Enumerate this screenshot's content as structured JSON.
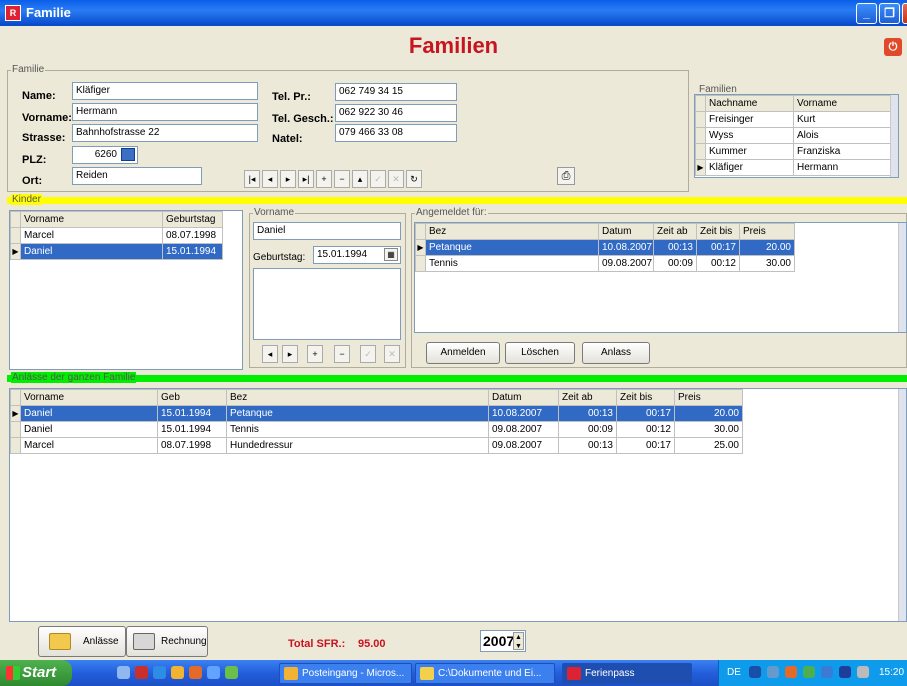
{
  "window": {
    "title": "Familie",
    "app_icon": "app-icon",
    "buttons": [
      "minimize-icon",
      "maximize-icon",
      "close-icon"
    ]
  },
  "page_title": "Familien",
  "familie": {
    "group_label": "Familie",
    "name_label": "Name:",
    "name": "Kläfiger",
    "vorname_label": "Vorname:",
    "vorname": "Hermann",
    "strasse_label": "Strasse:",
    "strasse": "Bahnhofstrasse 22",
    "plz_label": "PLZ:",
    "plz": "6260",
    "ort_label": "Ort:",
    "ort": "Reiden",
    "tel_pr_label": "Tel. Pr.:",
    "tel_pr": "062 749 34 15",
    "tel_gesch_label": "Tel. Gesch.:",
    "tel_gesch": "062 922 30 46",
    "natel_label": "Natel:",
    "natel": "079 466 33 08",
    "nav_icons": [
      "first-icon",
      "prev-icon",
      "next-icon",
      "last-icon",
      "add-icon",
      "delete-icon",
      "edit-icon",
      "post-icon",
      "cancel-icon",
      "refresh-icon"
    ]
  },
  "familien_list": {
    "group_label": "Familien",
    "columns": [
      "Nachname",
      "Vorname"
    ],
    "rows": [
      [
        "Freisinger",
        "Kurt"
      ],
      [
        "Wyss",
        "Alois"
      ],
      [
        "Kummer",
        "Franziska"
      ],
      [
        "Kläfiger",
        "Hermann"
      ]
    ],
    "current_row": 3
  },
  "kinder": {
    "bar_label": "Kinder",
    "columns": [
      "Vorname",
      "Geburtstag"
    ],
    "rows": [
      [
        "Marcel",
        "08.07.1998"
      ],
      [
        "Daniel",
        "15.01.1994"
      ]
    ],
    "selected_row": 1,
    "detail": {
      "group_label": "Vorname",
      "vorname": "Daniel",
      "geburtstag_label": "Geburtstag:",
      "geburtstag": "15.01.1994"
    }
  },
  "angemeldet": {
    "group_label": "Angemeldet für:",
    "columns": [
      "Bez",
      "Datum",
      "Zeit ab",
      "Zeit bis",
      "Preis"
    ],
    "rows": [
      [
        "Petanque",
        "10.08.2007",
        "00:13",
        "00:17",
        "20.00"
      ],
      [
        "Tennis",
        "09.08.2007",
        "00:09",
        "00:12",
        "30.00"
      ]
    ],
    "selected_row": 0,
    "buttons": {
      "anmelden": "Anmelden",
      "loeschen": "Löschen",
      "anlass": "Anlass"
    }
  },
  "anlaesse_familie": {
    "bar_label": "Anlässe der ganzen Familie",
    "columns": [
      "Vorname",
      "Geb",
      "Bez",
      "Datum",
      "Zeit ab",
      "Zeit bis",
      "Preis"
    ],
    "rows": [
      [
        "Daniel",
        "15.01.1994",
        "Petanque",
        "10.08.2007",
        "00:13",
        "00:17",
        "20.00"
      ],
      [
        "Daniel",
        "15.01.1994",
        "Tennis",
        "09.08.2007",
        "00:09",
        "00:12",
        "30.00"
      ],
      [
        "Marcel",
        "08.07.1998",
        "Hundedressur",
        "09.08.2007",
        "00:13",
        "00:17",
        "25.00"
      ]
    ],
    "selected_row": 0
  },
  "footer": {
    "anlaesse_button": "Anlässe",
    "rechnung_button": "Rechnung",
    "total_label": "Total SFR.:",
    "total_value": "95.00",
    "year": "2007"
  },
  "taskbar": {
    "start": "Start",
    "items": [
      "Posteingang - Micros...",
      "C:\\Dokumente und Ei...",
      "Ferienpass"
    ],
    "active_item": 2,
    "lang": "DE",
    "clock": "15:20"
  },
  "colors": {
    "accent_red": "#c8141e",
    "selection": "#316ac5",
    "kinder_bar": "#ffff00",
    "family_bar": "#00ee00"
  }
}
